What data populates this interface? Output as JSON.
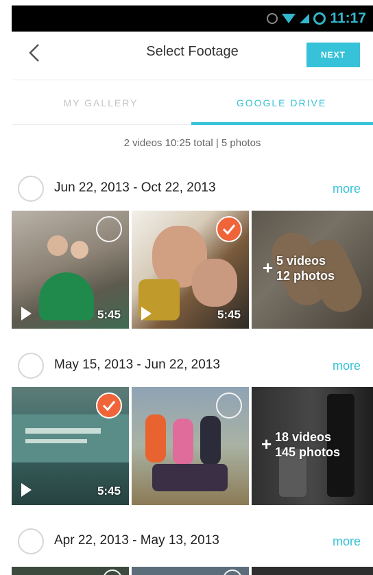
{
  "status": {
    "time": "11:17",
    "icons": [
      "sync-icon",
      "wifi-icon",
      "signal-icon",
      "battery-icon"
    ],
    "accent": "#33b6cc"
  },
  "header": {
    "title": "Select Footage",
    "next_label": "NEXT",
    "accent": "#36c2d8"
  },
  "tabs": [
    {
      "label": "MY GALLERY",
      "active": false
    },
    {
      "label": "GOOGLE DRIVE",
      "active": true
    }
  ],
  "summary": "2 videos 10:25 total | 5 photos",
  "sections": [
    {
      "range": "Jun 22, 2013 - Oct 22, 2013",
      "more": "more",
      "thumbs": [
        {
          "type": "video",
          "duration": "5:45",
          "selected": false
        },
        {
          "type": "video",
          "duration": "5:45",
          "selected": true
        }
      ],
      "overflow": {
        "plus": "+",
        "videos": "5 videos",
        "photos": "12 photos"
      }
    },
    {
      "range": "May 15, 2013 - Jun 22, 2013",
      "more": "more",
      "thumbs": [
        {
          "type": "video",
          "duration": "5:45",
          "selected": true
        },
        {
          "type": "photo",
          "selected": false
        }
      ],
      "overflow": {
        "plus": "+",
        "videos": "18 videos",
        "photos": "145 photos"
      }
    },
    {
      "range": "Apr 22, 2013 - May 13, 2013",
      "more": "more"
    }
  ]
}
